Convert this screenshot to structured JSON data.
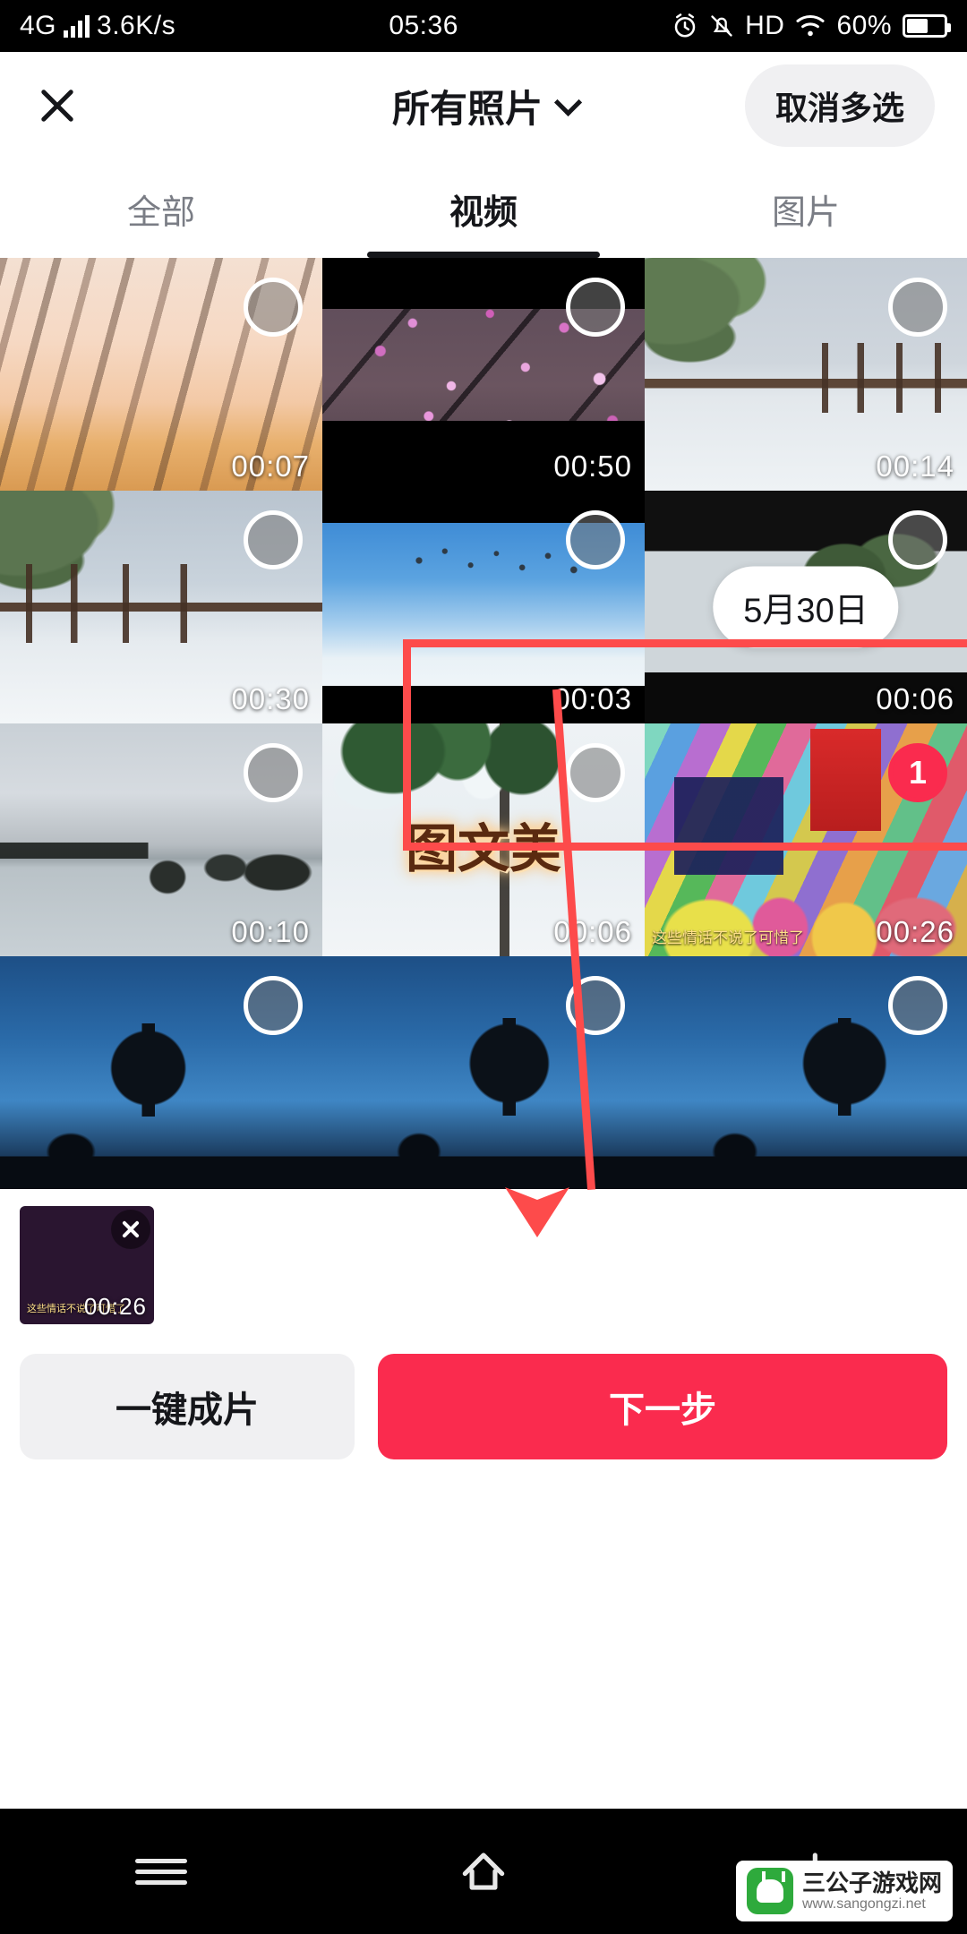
{
  "status_bar": {
    "network": "4G",
    "speed": "3.6K/s",
    "time": "05:36",
    "hd": "HD",
    "battery_percent": "60%",
    "icons": [
      "signal-bars-icon",
      "alarm-icon",
      "mute-bell-icon",
      "hd-icon",
      "wifi-icon",
      "battery-icon"
    ]
  },
  "header": {
    "close_icon": "close-icon",
    "title": "所有照片",
    "chevron": "chevron-down-icon",
    "multi_select_label": "取消多选"
  },
  "tabs": [
    {
      "label": "全部",
      "active": false
    },
    {
      "label": "视频",
      "active": true
    },
    {
      "label": "图片",
      "active": false
    }
  ],
  "date_pill": "5月30日",
  "grid": [
    {
      "duration": "00:07",
      "selected": false,
      "badge": ""
    },
    {
      "duration": "00:50",
      "selected": false,
      "badge": ""
    },
    {
      "duration": "00:14",
      "selected": false,
      "badge": ""
    },
    {
      "duration": "00:30",
      "selected": false,
      "badge": ""
    },
    {
      "duration": "00:03",
      "selected": false,
      "badge": ""
    },
    {
      "duration": "00:06",
      "selected": false,
      "badge": ""
    },
    {
      "duration": "00:10",
      "selected": false,
      "badge": ""
    },
    {
      "duration": "00:06",
      "selected": false,
      "badge": "",
      "overlay_text": "图文美"
    },
    {
      "duration": "00:26",
      "selected": true,
      "badge": "1",
      "caption": "这些情话不说了可惜了"
    },
    {
      "duration": "",
      "selected": false,
      "badge": ""
    },
    {
      "duration": "",
      "selected": false,
      "badge": ""
    },
    {
      "duration": "",
      "selected": false,
      "badge": ""
    }
  ],
  "selected_strip": [
    {
      "duration": "00:26",
      "remove_icon": "close-icon",
      "caption": "这些情话不说了可惜了"
    }
  ],
  "actions": {
    "secondary_label": "一键成片",
    "primary_label": "下一步"
  },
  "nav_bar": {
    "menu_icon": "menu-icon",
    "home_icon": "home-icon",
    "back_icon": "back-icon"
  },
  "watermark": {
    "title": "三公子游戏网",
    "url": "www.sangongzi.net"
  },
  "colors": {
    "accent": "#fa2b4e",
    "annotation": "#fd4b4b",
    "text_primary": "#15161a",
    "text_muted": "#7a7d85",
    "chip_bg": "#f0f0f2"
  }
}
